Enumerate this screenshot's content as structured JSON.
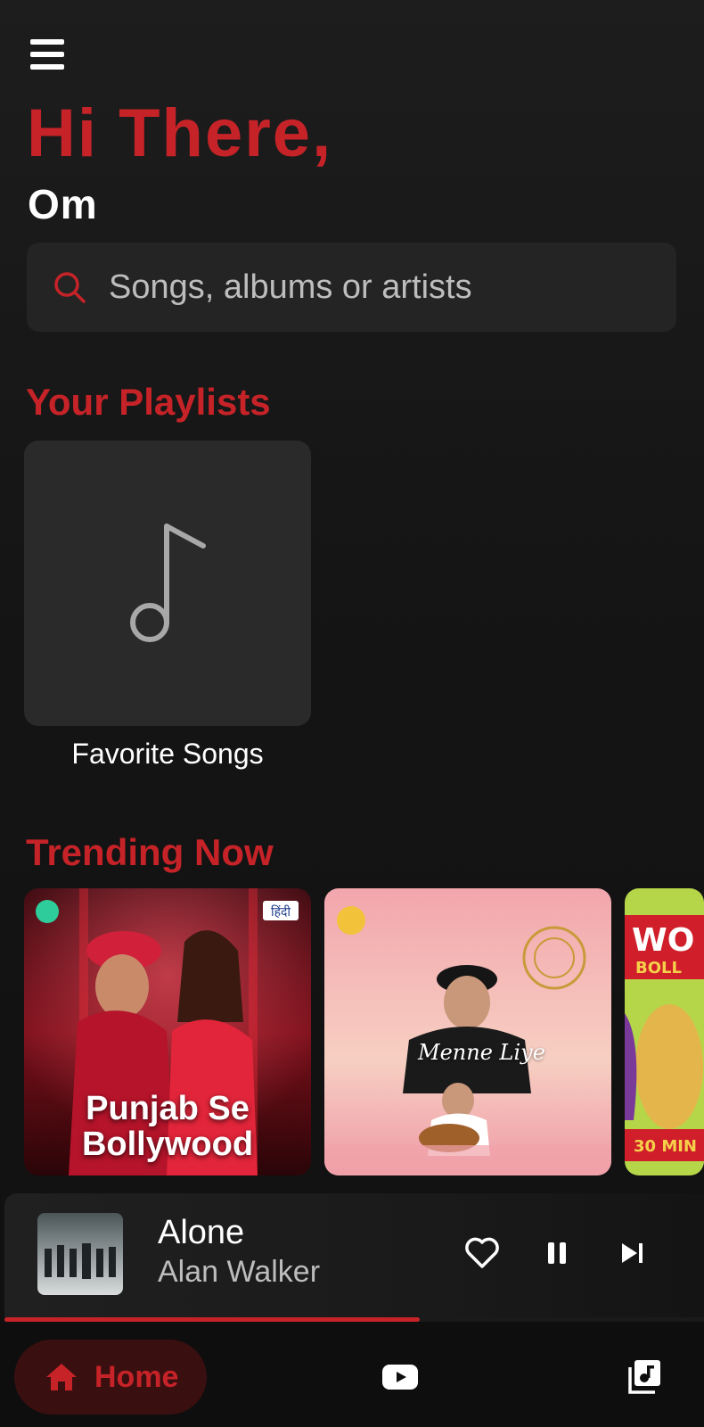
{
  "header": {
    "greeting": "Hi There,",
    "username": "Om"
  },
  "search": {
    "placeholder": "Songs, albums or artists"
  },
  "sections": {
    "playlists_title": "Your Playlists",
    "trending_title": "Trending Now"
  },
  "playlists": [
    {
      "label": "Favorite Songs",
      "icon": "music-note-icon"
    }
  ],
  "trending": [
    {
      "title_line1": "Punjab Se",
      "title_line2": "Bollywood",
      "badge": "हिंदी"
    },
    {
      "script_title": "Menne Liye"
    },
    {
      "partial_title": "WO",
      "partial_sub": "BOLL",
      "partial_footer": "30 MIN"
    }
  ],
  "player": {
    "title": "Alone",
    "artist": "Alan Walker",
    "progress": 0.59,
    "icons": [
      "heart-icon",
      "pause-icon",
      "skip-next-icon"
    ]
  },
  "nav": {
    "home_label": "Home",
    "icons": [
      "home-icon",
      "youtube-icon",
      "library-music-icon"
    ]
  },
  "colors": {
    "accent": "#c62328",
    "background": "#121212",
    "card": "#2a2a2a",
    "search_bg": "#242424",
    "home_pill": "#3a0f10"
  }
}
